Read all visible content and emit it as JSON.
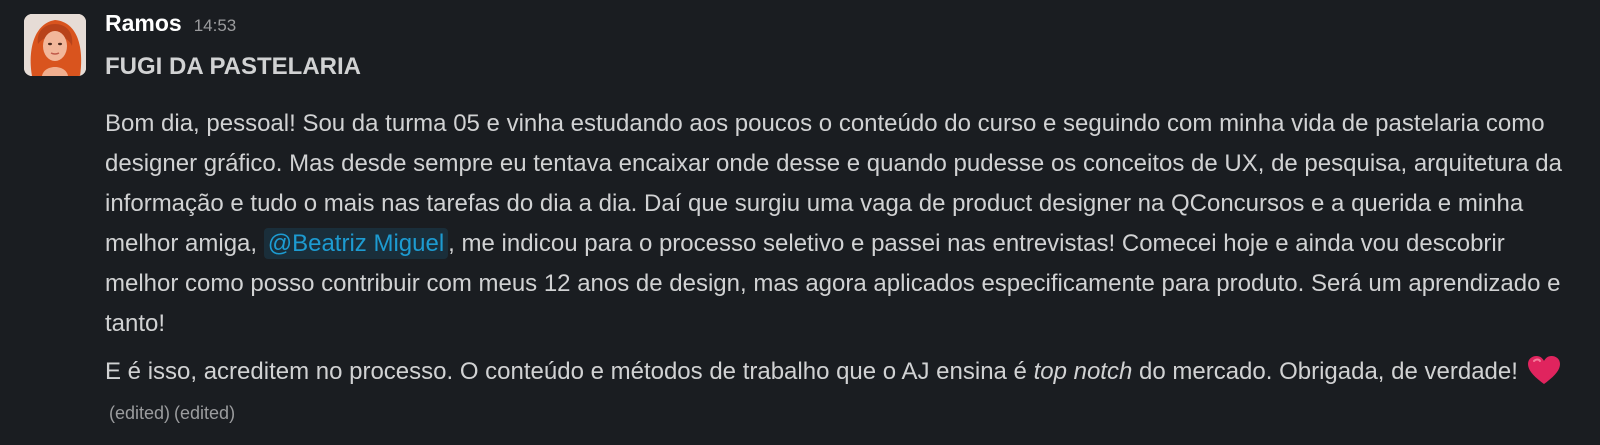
{
  "message": {
    "author": "Ramos",
    "timestamp": "14:53",
    "title": "FUGI DA PASTELARIA",
    "paragraph1": {
      "before_mention": "Bom dia, pessoal! Sou da turma 05 e vinha estudando aos poucos o conteúdo do curso e seguindo com minha vida de pastelaria como designer gráfico. Mas desde sempre eu tentava encaixar onde desse e quando pudesse os conceitos de UX, de pesquisa, arquitetura da informação e tudo o mais nas tarefas do dia a dia. Daí que surgiu uma vaga de product designer na QConcursos e a querida e minha melhor amiga, ",
      "mention": "@Beatriz Miguel",
      "after_mention": ", me indicou para o processo seletivo e passei nas entrevistas! Comecei hoje e ainda vou descobrir melhor como posso contribuir com meus 12 anos de design, mas agora aplicados especificamente para produto. Será um aprendizado e tanto!"
    },
    "paragraph2": {
      "before_italic": "E é isso, acreditem no processo. O conteúdo e métodos de trabalho que o AJ ensina é ",
      "italic": "top notch",
      "after_italic": " do mercado. Obrigada, de verdade! ",
      "emoji": "heart-emoji",
      "edited_1": "(edited)",
      "edited_2": "(edited)"
    }
  },
  "colors": {
    "background": "#1a1d21",
    "text": "#d1d2d3",
    "author": "#ffffff",
    "muted": "#9b9c9e",
    "mention": "#1d9bd1",
    "heart": "#e0245e"
  }
}
